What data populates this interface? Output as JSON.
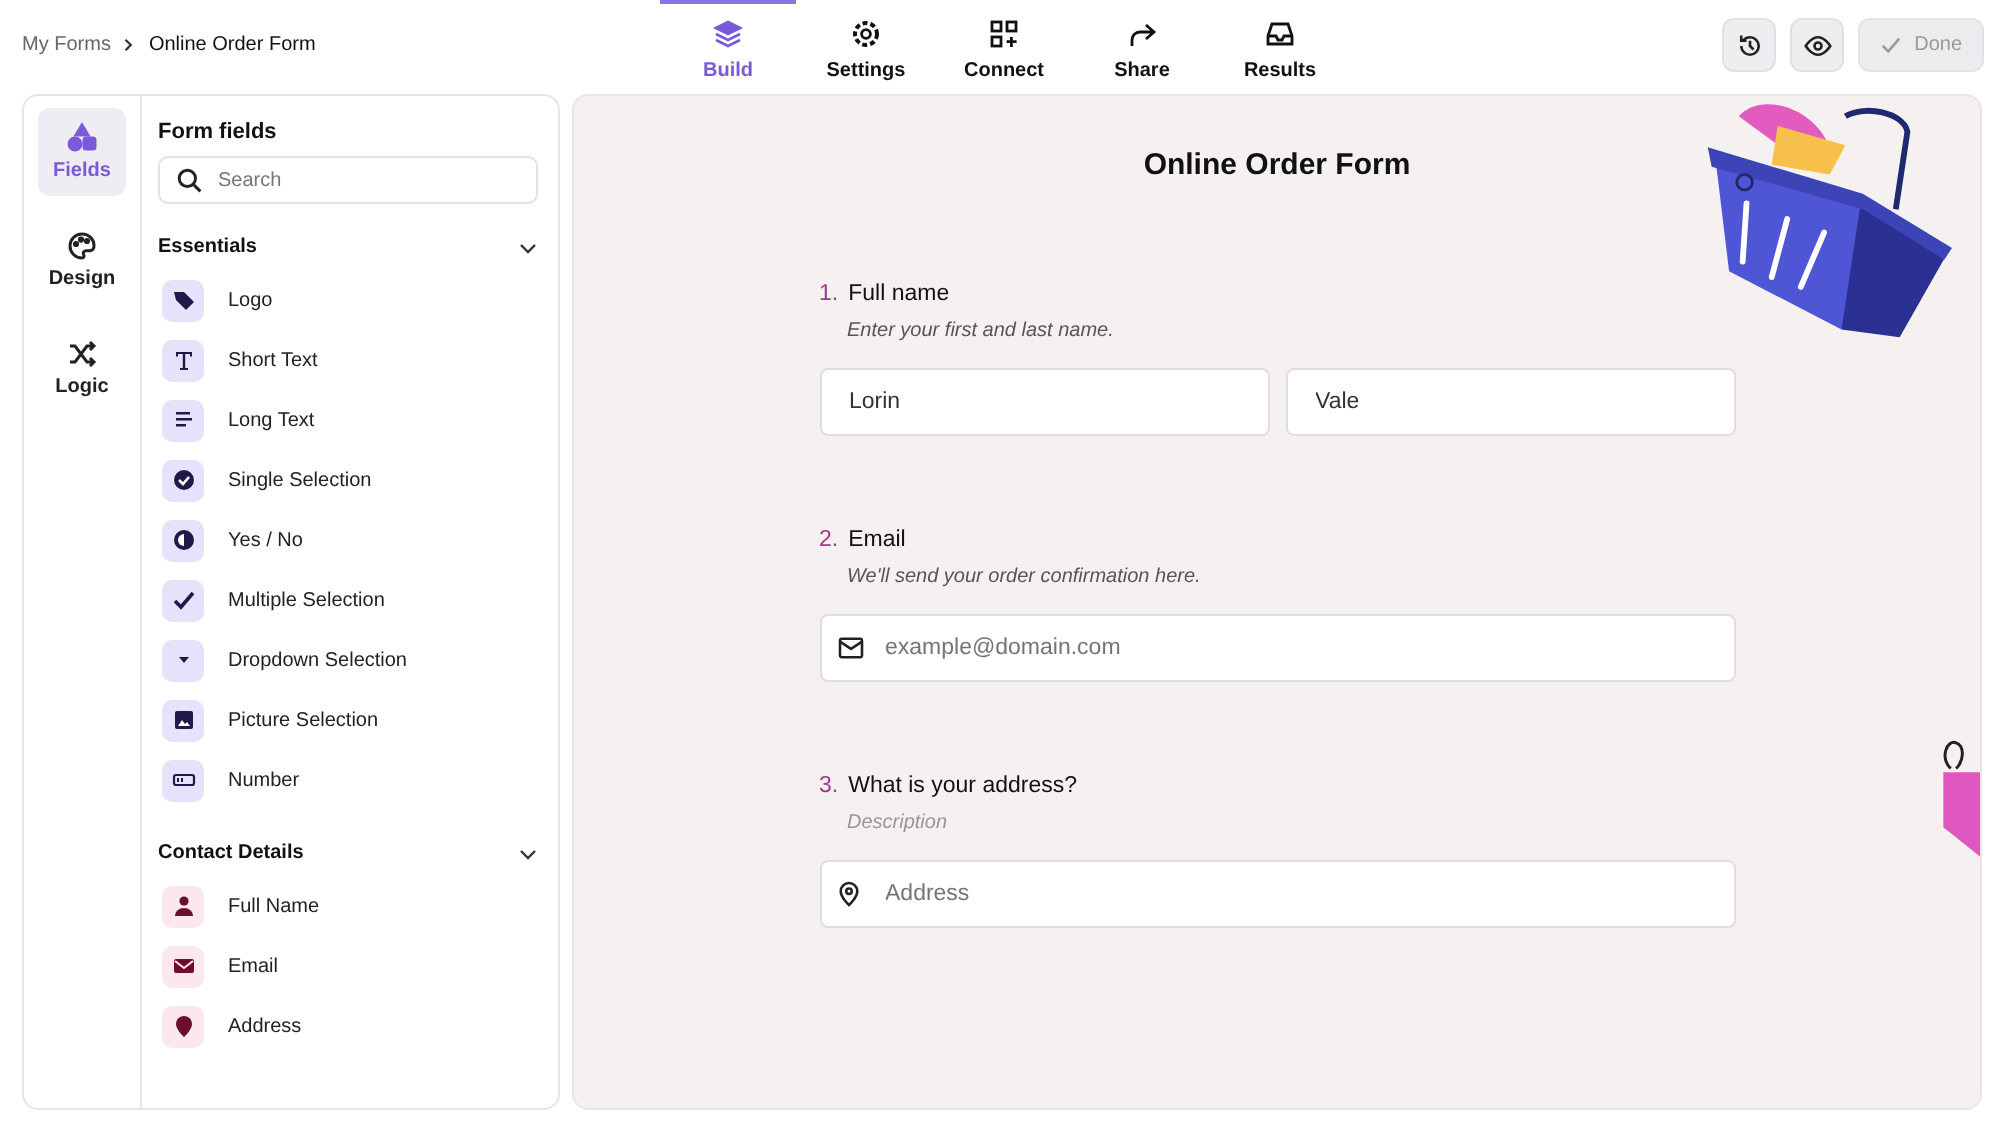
{
  "breadcrumb": [
    "My Forms",
    "Online Order Form"
  ],
  "nav_tabs": [
    {
      "label": "Build",
      "selected": true
    },
    {
      "label": "Settings",
      "selected": false
    },
    {
      "label": "Connect",
      "selected": false
    },
    {
      "label": "Share",
      "selected": false
    },
    {
      "label": "Results",
      "selected": false
    }
  ],
  "done_button": {
    "label": "Done",
    "disabled": true
  },
  "rail": [
    {
      "label": "Fields",
      "selected": true
    },
    {
      "label": "Design",
      "selected": false
    },
    {
      "label": "Logic",
      "selected": false
    }
  ],
  "panel": {
    "title": "Form fields",
    "search": {
      "placeholder": "Search"
    },
    "groups": [
      {
        "title": "Essentials",
        "expanded": true,
        "items": [
          "Logo",
          "Short Text",
          "Long Text",
          "Single Selection",
          "Yes / No",
          "Multiple Selection",
          "Dropdown Selection",
          "Picture Selection",
          "Number"
        ]
      },
      {
        "title": "Contact Details",
        "expanded": true,
        "items": [
          "Full Name",
          "Email",
          "Address"
        ]
      }
    ]
  },
  "form": {
    "title": "Online Order Form",
    "questions": [
      {
        "number": "1.",
        "label": "Full name",
        "description": "Enter your first and last name.",
        "description_empty": false,
        "kind": "name",
        "inputs": [
          {
            "value": "Lorin"
          },
          {
            "value": "Vale"
          }
        ]
      },
      {
        "number": "2.",
        "label": "Email",
        "description": "We'll send your order confirmation here.",
        "description_empty": false,
        "kind": "email",
        "inputs": [
          {
            "placeholder": "example@domain.com"
          }
        ]
      },
      {
        "number": "3.",
        "label": "What is your address?",
        "description": "Description",
        "description_empty": true,
        "kind": "address",
        "inputs": [
          {
            "placeholder": "Address"
          }
        ]
      }
    ]
  }
}
